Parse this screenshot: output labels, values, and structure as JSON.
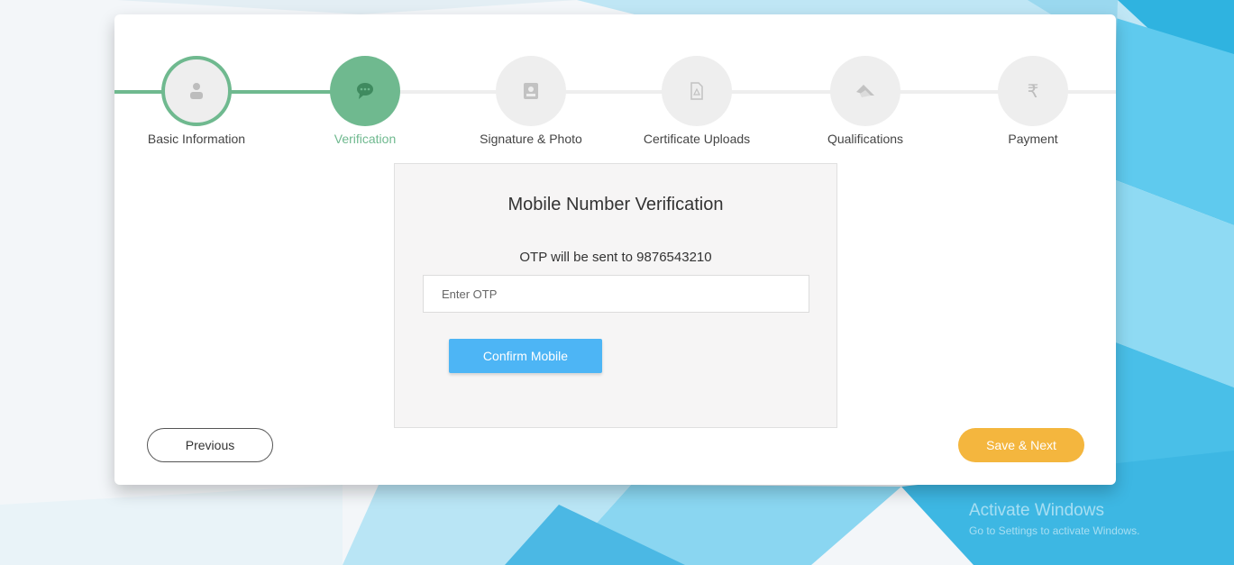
{
  "steps": [
    {
      "label": "Basic Information",
      "icon": "user-icon",
      "state": "done"
    },
    {
      "label": "Verification",
      "icon": "sms-icon",
      "state": "active"
    },
    {
      "label": "Signature & Photo",
      "icon": "id-card-icon",
      "state": "todo"
    },
    {
      "label": "Certificate Uploads",
      "icon": "pdf-file-icon",
      "state": "todo"
    },
    {
      "label": "Qualifications",
      "icon": "graduation-cap-icon",
      "state": "todo"
    },
    {
      "label": "Payment",
      "icon": "rupee-icon",
      "state": "todo"
    }
  ],
  "verification": {
    "title": "Mobile Number Verification",
    "otp_note": "OTP will be sent to 9876543210",
    "otp_placeholder": "Enter OTP",
    "otp_value": "",
    "confirm_label": "Confirm Mobile"
  },
  "nav": {
    "previous_label": "Previous",
    "next_label": "Save & Next"
  },
  "watermark": {
    "line1": "Activate Windows",
    "line2": "Go to Settings to activate Windows."
  },
  "colors": {
    "accent_green": "#6fb98f",
    "confirm_blue": "#4db5f5",
    "save_orange": "#f4b63e"
  }
}
